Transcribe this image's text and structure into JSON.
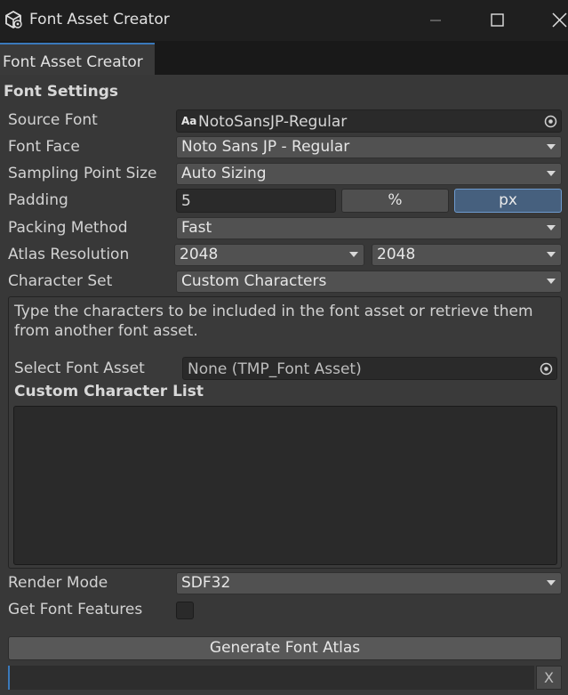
{
  "window": {
    "title": "Font Asset Creator"
  },
  "tab": {
    "label": "Font Asset Creator"
  },
  "font_settings": {
    "title": "Font Settings",
    "source_font": {
      "label": "Source Font",
      "value": "NotoSansJP-Regular",
      "icon": "Aa"
    },
    "font_face": {
      "label": "Font Face",
      "value": "Noto Sans JP - Regular"
    },
    "sampling_point_size": {
      "label": "Sampling Point Size",
      "value": "Auto Sizing"
    },
    "padding": {
      "label": "Padding",
      "value": "5",
      "unit_percent": "%",
      "unit_px": "px",
      "selected_unit": "px"
    },
    "packing_method": {
      "label": "Packing Method",
      "value": "Fast"
    },
    "atlas_resolution": {
      "label": "Atlas Resolution",
      "width": "2048",
      "height": "2048"
    },
    "character_set": {
      "label": "Character Set",
      "value": "Custom Characters"
    },
    "custom_panel": {
      "help_text": "Type the characters to be included in the font asset or retrieve them from another font asset.",
      "select_font_asset": {
        "label": "Select Font Asset",
        "value": "None (TMP_Font Asset)"
      },
      "custom_character_list_title": "Custom Character List",
      "custom_character_list_value": ""
    },
    "render_mode": {
      "label": "Render Mode",
      "value": "SDF32"
    },
    "get_font_features": {
      "label": "Get Font Features",
      "checked": false
    }
  },
  "actions": {
    "generate_label": "Generate Font Atlas",
    "clear_label": "X"
  },
  "colors": {
    "accent": "#3a79bb",
    "selected_unit_bg": "#46607e",
    "panel_bg": "#383838",
    "titlebar_bg": "#1f1f1f"
  }
}
